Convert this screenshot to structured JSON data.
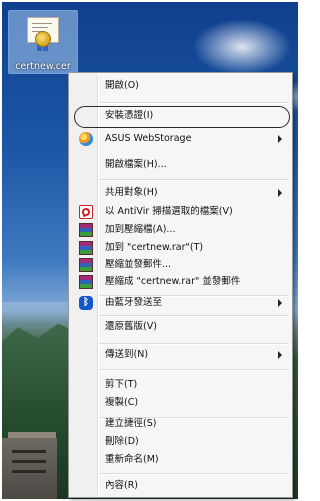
{
  "desktop": {
    "icon_label": "certnew.cer"
  },
  "menu": {
    "items": [
      {
        "label": "開啟(O)"
      },
      {
        "label": "安裝憑證(I)"
      },
      {
        "label": "ASUS WebStorage"
      },
      {
        "label": "開啟檔案(H)..."
      },
      {
        "label": "共用對象(H)"
      },
      {
        "label": "以 AntiVir 掃描選取的檔案(V)"
      },
      {
        "label": "加到壓縮檔(A)..."
      },
      {
        "label": "加到 \"certnew.rar\"(T)"
      },
      {
        "label": "壓縮並發郵件..."
      },
      {
        "label": "壓縮成 \"certnew.rar\" 並發郵件"
      },
      {
        "label": "由藍牙發送至"
      },
      {
        "label": "還原舊版(V)"
      },
      {
        "label": "傳送到(N)"
      },
      {
        "label": "剪下(T)"
      },
      {
        "label": "複製(C)"
      },
      {
        "label": "建立捷徑(S)"
      },
      {
        "label": "刪除(D)"
      },
      {
        "label": "重新命名(M)"
      },
      {
        "label": "內容(R)"
      }
    ],
    "icons": {
      "asus": "asus-webstorage-icon",
      "avira": "avira-antivir-icon",
      "rar": "winrar-icon",
      "bluetooth": "bluetooth-icon"
    }
  }
}
